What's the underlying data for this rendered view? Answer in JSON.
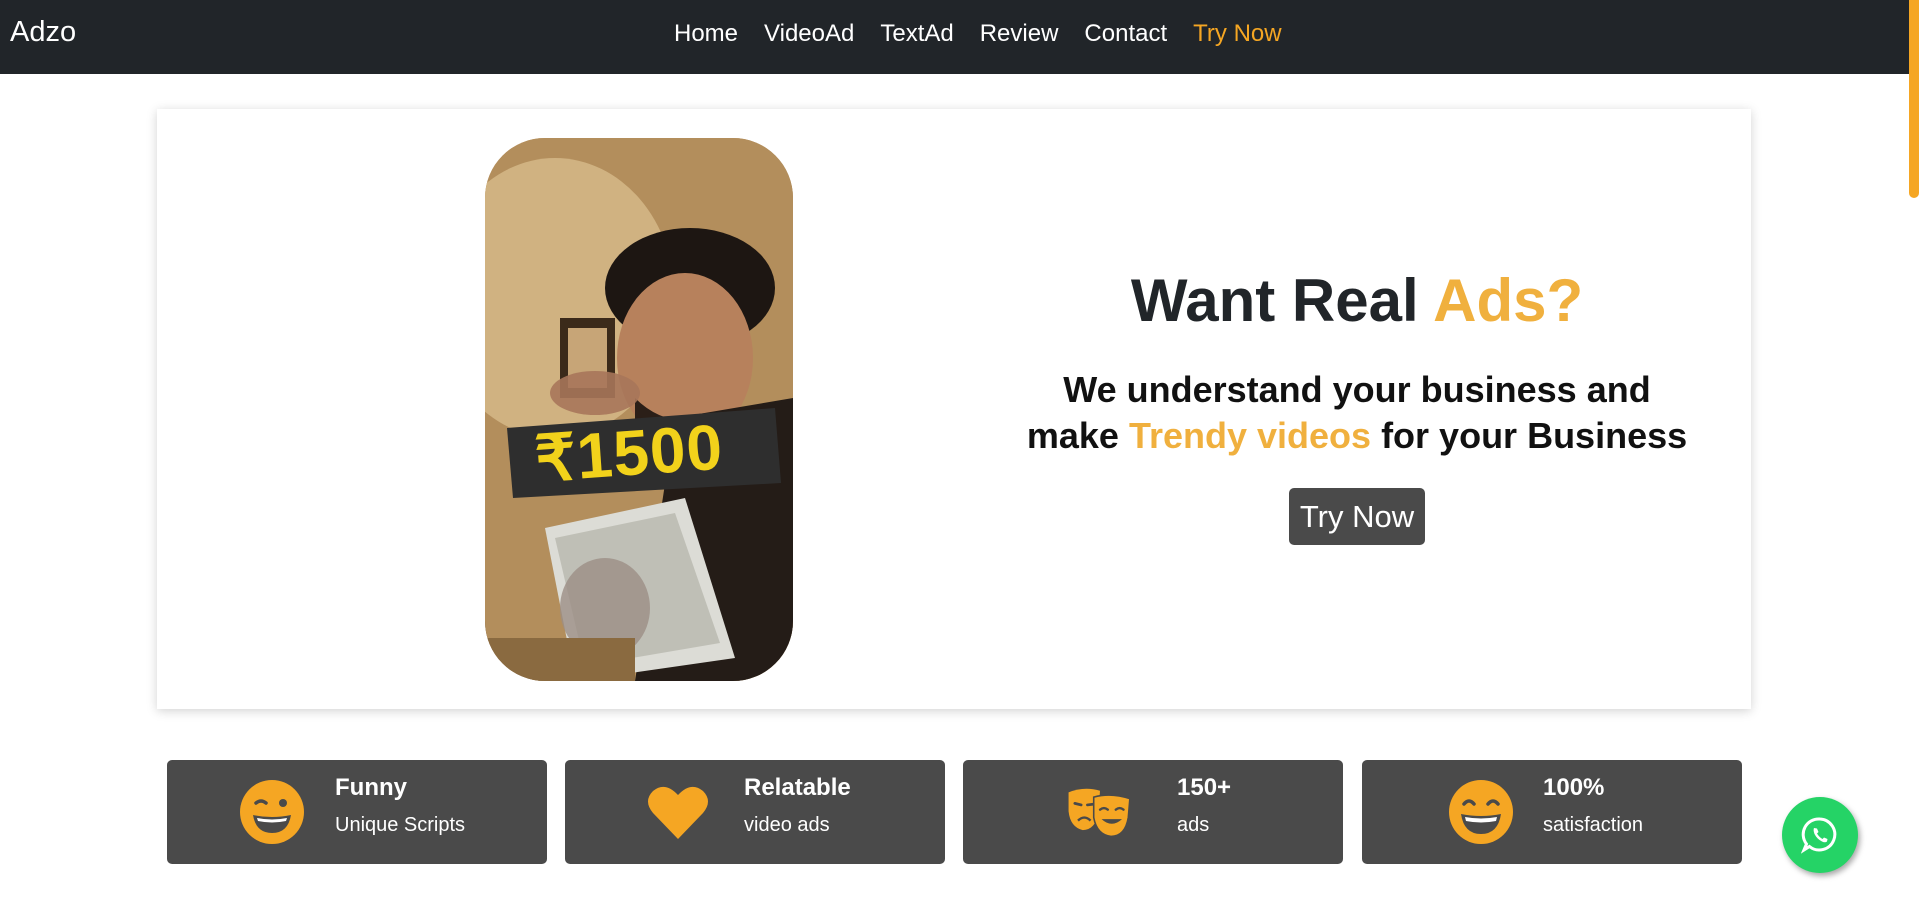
{
  "nav": {
    "brand": "Adzo",
    "links": [
      {
        "label": "Home"
      },
      {
        "label": "VideoAd"
      },
      {
        "label": "TextAd"
      },
      {
        "label": "Review"
      },
      {
        "label": "Contact"
      },
      {
        "label": "Try Now"
      }
    ]
  },
  "hero": {
    "title_prefix": "Want Real",
    "title_accent": "Ads?",
    "sub_line1": "We understand your business and",
    "sub_line2_prefix": "make",
    "sub_line2_accent": "Trendy videos",
    "sub_line2_suffix": "for your Business",
    "cta_label": "Try Now",
    "video_overlay_text": "₹1500"
  },
  "features": [
    {
      "title": "Funny",
      "subtitle": "Unique Scripts",
      "icon": "wink-face-icon"
    },
    {
      "title": "Relatable",
      "subtitle": "video ads",
      "icon": "heart-icon"
    },
    {
      "title": "150+",
      "subtitle": "ads",
      "icon": "theater-masks-icon"
    },
    {
      "title": "100%",
      "subtitle": "satisfaction",
      "icon": "grin-face-icon"
    }
  ],
  "floating": {
    "icon": "whatsapp-icon"
  },
  "colors": {
    "accent": "#f0b03e",
    "nav_bg": "#212529",
    "card_bg": "#4a4a4a",
    "whatsapp": "#25d366"
  }
}
